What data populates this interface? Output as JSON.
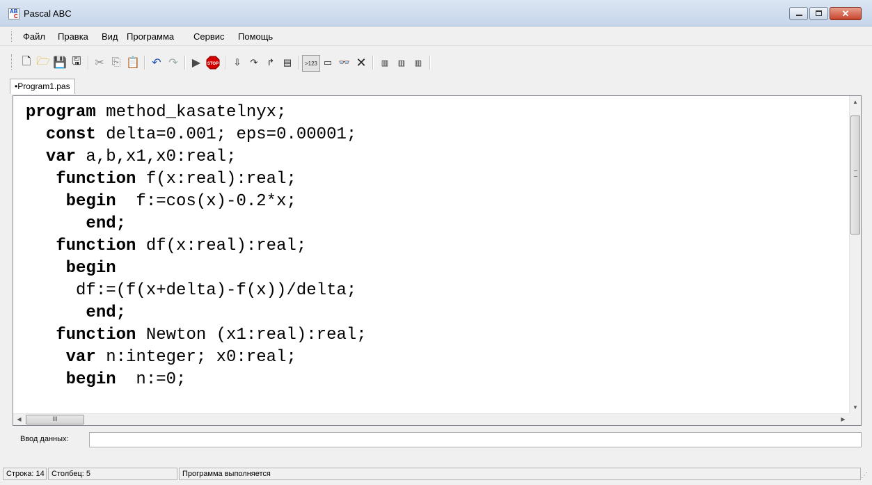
{
  "window": {
    "title": "Pascal ABC",
    "icon": "pascal-abc-icon"
  },
  "menu": [
    "Файл",
    "Правка",
    "Вид",
    "Программа",
    "Сервис",
    "Помощь"
  ],
  "toolbar_icons": [
    "new-file",
    "open-folder",
    "save",
    "save-all",
    "cut",
    "copy",
    "paste",
    "undo",
    "redo",
    "run",
    "stop",
    "step-into",
    "step-over",
    "step-out",
    "add-watch",
    "output-window",
    "input-window",
    "watch-window",
    "clear",
    "doc-d",
    "doc-l",
    "doc-r"
  ],
  "tabs": [
    {
      "label": "•Program1.pas",
      "active": true
    }
  ],
  "editor": {
    "lines": [
      [
        {
          "t": "program",
          "kw": true
        },
        {
          "t": " method_kasatelnyx;"
        }
      ],
      [
        {
          "t": "  "
        },
        {
          "t": "const",
          "kw": true
        },
        {
          "t": " delta=0.001; eps=0.00001;"
        }
      ],
      [
        {
          "t": "  "
        },
        {
          "t": "var",
          "kw": true
        },
        {
          "t": " a,b,x1,x0:real;"
        }
      ],
      [
        {
          "t": "   "
        },
        {
          "t": "function",
          "kw": true
        },
        {
          "t": " f(x:real):real;"
        }
      ],
      [
        {
          "t": "    "
        },
        {
          "t": "begin",
          "kw": true
        },
        {
          "t": "  f:=cos(x)-0.2*x;"
        }
      ],
      [
        {
          "t": "      "
        },
        {
          "t": "end;",
          "kw": true
        }
      ],
      [
        {
          "t": "   "
        },
        {
          "t": "function",
          "kw": true
        },
        {
          "t": " df(x:real):real;"
        }
      ],
      [
        {
          "t": "    "
        },
        {
          "t": "begin",
          "kw": true
        }
      ],
      [
        {
          "t": "     df:=(f(x+delta)-f(x))/delta;"
        }
      ],
      [
        {
          "t": "      "
        },
        {
          "t": "end;",
          "kw": true
        }
      ],
      [
        {
          "t": "   "
        },
        {
          "t": "function",
          "kw": true
        },
        {
          "t": " Newton (x1:real):real;"
        }
      ],
      [
        {
          "t": "    "
        },
        {
          "t": "var",
          "kw": true
        },
        {
          "t": " n:integer; x0:real;"
        }
      ],
      [
        {
          "t": "    "
        },
        {
          "t": "begin",
          "kw": true
        },
        {
          "t": "  n:=0;"
        }
      ]
    ]
  },
  "input": {
    "label": "Ввод данных:",
    "value": ""
  },
  "status": {
    "line": "Строка: 14",
    "column": "Столбец: 5",
    "message": "Программа выполняется"
  },
  "colors": {
    "titlebar": "#c6d5ea",
    "close_button": "#c7442b",
    "stop_icon": "#d40000",
    "editor_bg": "#ffffff"
  }
}
